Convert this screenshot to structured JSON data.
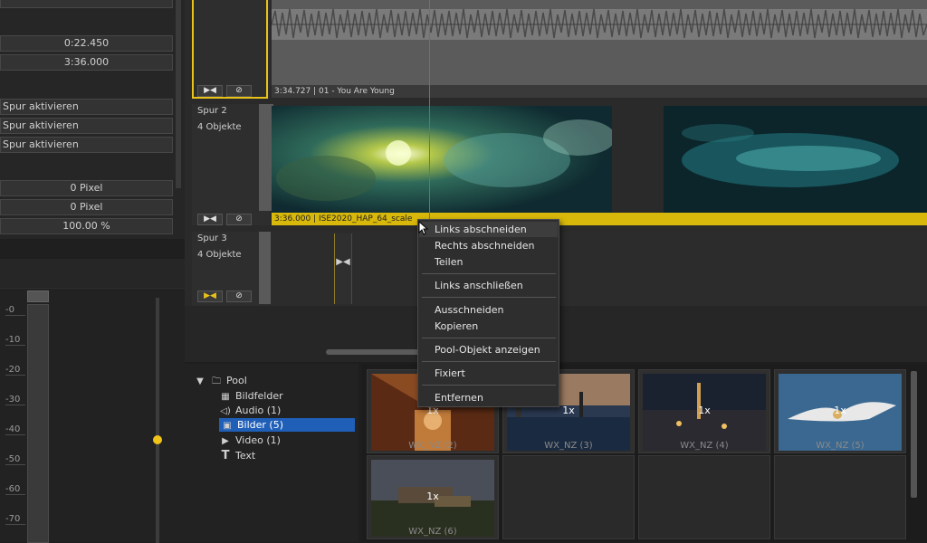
{
  "left_panel": {
    "fields": [
      {
        "value": "0:22.450",
        "align": "center"
      },
      {
        "value": "3:36.000",
        "align": "center"
      },
      {
        "value": "Spur aktivieren",
        "align": "left"
      },
      {
        "value": "Spur aktivieren",
        "align": "left"
      },
      {
        "value": "Spur aktivieren",
        "align": "left"
      },
      {
        "value": "0 Pixel",
        "align": "center"
      },
      {
        "value": "0 Pixel",
        "align": "center"
      },
      {
        "value": "100.00 %",
        "align": "center"
      }
    ],
    "meter": {
      "db_labels": [
        "-0",
        "-10",
        "-20",
        "-30",
        "-40",
        "-50",
        "-60",
        "-70"
      ],
      "fader_color": "#f0c419",
      "fader_level": 0.42
    }
  },
  "timeline": {
    "tracks": [
      {
        "name": "",
        "objects": "",
        "selected": true,
        "lock_icon": "bowtie-icon",
        "mute_icon": "circle-slash-icon",
        "lock_active": false
      },
      {
        "name": "Spur 2",
        "objects": "4 Objekte",
        "selected": false,
        "lock_icon": "bowtie-icon",
        "mute_icon": "circle-slash-icon",
        "lock_active": false
      },
      {
        "name": "Spur 3",
        "objects": "4 Objekte",
        "selected": false,
        "lock_icon": "bowtie-icon",
        "mute_icon": "circle-slash-icon",
        "lock_active": true
      }
    ],
    "audio_clip": {
      "label": "3:34.727 | 01 - You Are Young"
    },
    "video_clip": {
      "label": "3:36.000 | ISE2020_HAP_64_scale",
      "color": "#d8b80a"
    },
    "playhead_color": "#e04040",
    "spur3_marker_icon": "bowtie-icon",
    "accent": "#e8c218"
  },
  "context_menu": {
    "items": [
      {
        "label": "Links abschneiden",
        "hover": true
      },
      {
        "label": "Rechts abschneiden",
        "hover": false
      },
      {
        "label": "Teilen",
        "hover": false
      },
      {
        "separator": true
      },
      {
        "label": "Links anschließen",
        "hover": false
      },
      {
        "separator": true
      },
      {
        "label": "Ausschneiden",
        "hover": false
      },
      {
        "label": "Kopieren",
        "hover": false
      },
      {
        "separator": true
      },
      {
        "label": "Pool-Objekt anzeigen",
        "hover": false
      },
      {
        "separator": true
      },
      {
        "label": "Fixiert",
        "hover": false
      },
      {
        "separator": true
      },
      {
        "label": "Entfernen",
        "hover": false
      }
    ]
  },
  "pool": {
    "root": {
      "label": "Pool",
      "icon": "folder-icon",
      "expand_icon": "triangle-down-icon"
    },
    "items": [
      {
        "label": "Bildfelder",
        "icon": "grid-icon",
        "selected": false
      },
      {
        "label": "Audio (1)",
        "icon": "speaker-icon",
        "selected": false
      },
      {
        "label": "Bilder (5)",
        "icon": "image-icon",
        "selected": true
      },
      {
        "label": "Video (1)",
        "icon": "play-icon",
        "selected": false
      },
      {
        "label": "Text",
        "icon": "text-icon",
        "selected": false
      }
    ],
    "selected_color": "#1f5fb8"
  },
  "grid": {
    "thumbnails": [
      {
        "badge": "1x",
        "caption": "WX_NZ (2)"
      },
      {
        "badge": "1x",
        "caption": "WX_NZ (3)"
      },
      {
        "badge": "1x",
        "caption": "WX_NZ (4)"
      },
      {
        "badge": "1x",
        "caption": "WX_NZ (5)"
      },
      {
        "badge": "1x",
        "caption": "WX_NZ (6)"
      }
    ]
  }
}
